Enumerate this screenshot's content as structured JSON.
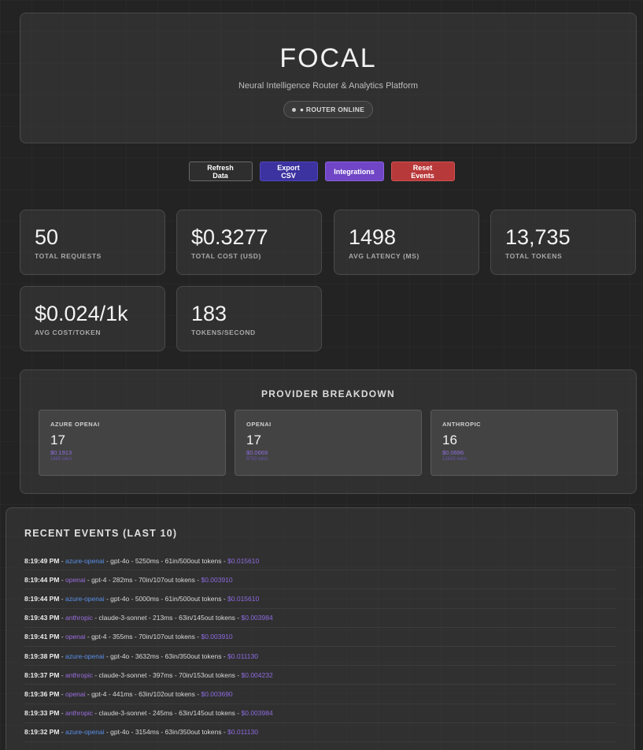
{
  "header": {
    "title": "FOCAL",
    "subtitle": "Neural Intelligence Router & Analytics Platform",
    "status": "● ROUTER ONLINE"
  },
  "toolbar": {
    "refresh_label": "Refresh Data",
    "export_label": "Export CSV",
    "integrations_label": "Integrations",
    "reset_label": "Reset Events"
  },
  "stats": [
    {
      "value": "50",
      "label": "TOTAL REQUESTS"
    },
    {
      "value": "$0.3277",
      "label": "TOTAL COST (USD)"
    },
    {
      "value": "1498",
      "label": "AVG LATENCY (MS)"
    },
    {
      "value": "13,735",
      "label": "TOTAL TOKENS"
    },
    {
      "value": "$0.024/1k",
      "label": "AVG COST/TOKEN"
    },
    {
      "value": "183",
      "label": "TOKENS/SECOND"
    }
  ],
  "providers": {
    "title": "PROVIDER BREAKDOWN",
    "cards": [
      {
        "name": "AZURE OPENAI",
        "count": "17",
        "cost": "$0.1913",
        "rate": "1865 tok/s"
      },
      {
        "name": "OPENAI",
        "count": "17",
        "cost": "$0.0669",
        "rate": "9793 tok/s"
      },
      {
        "name": "ANTHROPIC",
        "count": "16",
        "cost": "$0.0696",
        "rate": "12633 tok/s"
      }
    ]
  },
  "events": {
    "title": "RECENT EVENTS (LAST 10)",
    "rows": [
      {
        "time": "8:19:49 PM",
        "provider": "azure-openai",
        "detail": "gpt-4o - 5250ms - 61in/500out tokens",
        "cost": "$0.015610"
      },
      {
        "time": "8:19:44 PM",
        "provider": "openai",
        "detail": "gpt-4 - 282ms - 70in/107out tokens",
        "cost": "$0.003910"
      },
      {
        "time": "8:19:44 PM",
        "provider": "azure-openai",
        "detail": "gpt-4o - 5000ms - 61in/500out tokens",
        "cost": "$0.015610"
      },
      {
        "time": "8:19:43 PM",
        "provider": "anthropic",
        "detail": "claude-3-sonnet - 213ms - 63in/145out tokens",
        "cost": "$0.003984"
      },
      {
        "time": "8:19:41 PM",
        "provider": "openai",
        "detail": "gpt-4 - 355ms - 70in/107out tokens",
        "cost": "$0.003910"
      },
      {
        "time": "8:19:38 PM",
        "provider": "azure-openai",
        "detail": "gpt-4o - 3632ms - 63in/350out tokens",
        "cost": "$0.011130"
      },
      {
        "time": "8:19:37 PM",
        "provider": "anthropic",
        "detail": "claude-3-sonnet - 397ms - 70in/153out tokens",
        "cost": "$0.004232"
      },
      {
        "time": "8:19:36 PM",
        "provider": "openai",
        "detail": "gpt-4 - 441ms - 63in/102out tokens",
        "cost": "$0.003690"
      },
      {
        "time": "8:19:33 PM",
        "provider": "anthropic",
        "detail": "claude-3-sonnet - 245ms - 63in/145out tokens",
        "cost": "$0.003984"
      },
      {
        "time": "8:19:32 PM",
        "provider": "azure-openai",
        "detail": "gpt-4o - 3154ms - 63in/350out tokens",
        "cost": "$0.011130"
      }
    ]
  }
}
